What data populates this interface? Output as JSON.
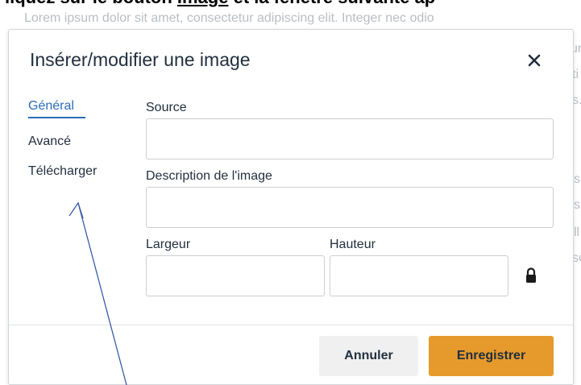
{
  "background": {
    "heading_prefix": "liquez sur le bouton ",
    "heading_bold_link": "Image",
    "heading_suffix": " et la fenêtre suivante ap",
    "lorem_line": "Lorem ipsum dolor sit amet, consectetur adipiscing elit. Integer nec odio",
    "fragments": [
      "ur",
      "ti",
      "s.",
      "s",
      "s",
      "ll",
      "sc"
    ]
  },
  "dialog": {
    "title": "Insérer/modifier une image",
    "close_icon": "close-icon",
    "nav": [
      {
        "label": "Général",
        "active": true
      },
      {
        "label": "Avancé",
        "active": false
      },
      {
        "label": "Télécharger",
        "active": false
      }
    ],
    "fields": {
      "source_label": "Source",
      "source_value": "",
      "description_label": "Description de l'image",
      "description_value": "",
      "width_label": "Largeur",
      "width_value": "",
      "height_label": "Hauteur",
      "height_value": "",
      "lock_icon": "lock-icon"
    },
    "footer": {
      "cancel_label": "Annuler",
      "save_label": "Enregistrer"
    }
  },
  "colors": {
    "accent": "#2b6cb8",
    "save_button": "#e69a2c",
    "annotation_arrow": "#3a5ba8"
  }
}
